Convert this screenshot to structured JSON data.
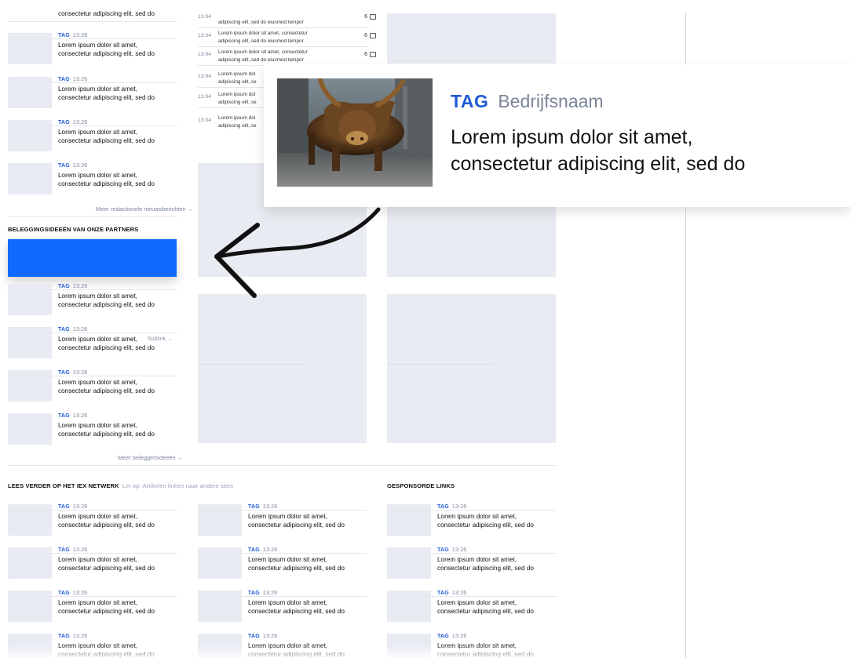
{
  "top_partial_title": "consectetur adipiscing elit, sed do",
  "left_items": [
    {
      "tag": "TAG",
      "time": "13:26",
      "title1": "Lorem ipsum dolor sit amet,",
      "title2": "consectetur adipiscing elit, sed do"
    },
    {
      "tag": "TAG",
      "time": "13:26",
      "title1": "Lorem ipsum dolor sit amet,",
      "title2": "consectetur adipiscing elit, sed do"
    },
    {
      "tag": "TAG",
      "time": "13:26",
      "title1": "Lorem ipsum dolor sit amet,",
      "title2": "consectetur adipiscing elit, sed do"
    },
    {
      "tag": "TAG",
      "time": "13:26",
      "title1": "Lorem ipsum dolor sit amet,",
      "title2": "consectetur adipiscing elit, sed do"
    }
  ],
  "more_editorial": "Meer redactionele nieuwsberichten →",
  "partners_section_title": "BELEGGINGSIDEEËN VAN ONZE PARTNERS",
  "partner_items": [
    {
      "tag": "TAG",
      "time": "13:26",
      "title1": "Lorem ipsum dolor sit amet,",
      "title2": "consectetur adipiscing elit, sed do"
    },
    {
      "tag": "TAG",
      "time": "13:26",
      "title1": "Lorem ipsum dolor sit amet,",
      "title2": "consectetur adipiscing elit, sed do",
      "sublink": "Sublink →"
    },
    {
      "tag": "TAG",
      "time": "13:26",
      "title1": "Lorem ipsum dolor sit amet,",
      "title2": "consectetur adipiscing elit, sed do"
    },
    {
      "tag": "TAG",
      "time": "13:26",
      "title1": "Lorem ipsum dolor sit amet,",
      "title2": "consectetur adipiscing elit, sed do"
    }
  ],
  "more_ideas": "Meer beleggersideeën →",
  "news_list": [
    {
      "time": "13:04",
      "line1": "",
      "line2": "adipiscing elit, sed do eiusmod tempor",
      "count": "6"
    },
    {
      "time": "13:04",
      "line1": "Lorem ipsum dolor sit amet, consectetur",
      "line2": "adipiscing elit, sed do eiusmod tempor",
      "count": "6"
    },
    {
      "time": "13:04",
      "line1": "Lorem ipsum dolor sit amet, consectetur",
      "line2": "adipiscing elit, sed do eiusmod tempor",
      "count": "6"
    },
    {
      "time": "13:04",
      "line1": "Lorem ipsum dol",
      "line2": "adipiscing elit, se",
      "count": ""
    },
    {
      "time": "13:04",
      "line1": "Lorem ipsum dol",
      "line2": "adipiscing elit, se",
      "count": ""
    },
    {
      "time": "13:04",
      "line1": "Lorem ipsum dol",
      "line2": "adipiscing elit, se",
      "count": ""
    }
  ],
  "zoom": {
    "tag": "TAG",
    "company": "Bedrijfsnaam",
    "title1": "Lorem ipsum dolor sit amet,",
    "title2": "consectetur adipiscing elit, sed do",
    "image_icon": "bull-statue-photo"
  },
  "iex_section": {
    "title": "LEES VERDER OP HET IEX NETWERK",
    "note": "Let op: Artikelen linken naar andere sites"
  },
  "sponsored_section": {
    "title": "GESPONSORDE LINKS"
  },
  "bottom_item": {
    "tag": "TAG",
    "time": "13:26",
    "title1": "Lorem ipsum dolor sit amet,",
    "title2": "consectetur adipiscing elit, sed do"
  },
  "colors": {
    "accent": "#1f5bd6",
    "banner": "#0f6bff",
    "placeholder": "#e8ebf1"
  },
  "annotation_icon": "curved-arrow-icon"
}
